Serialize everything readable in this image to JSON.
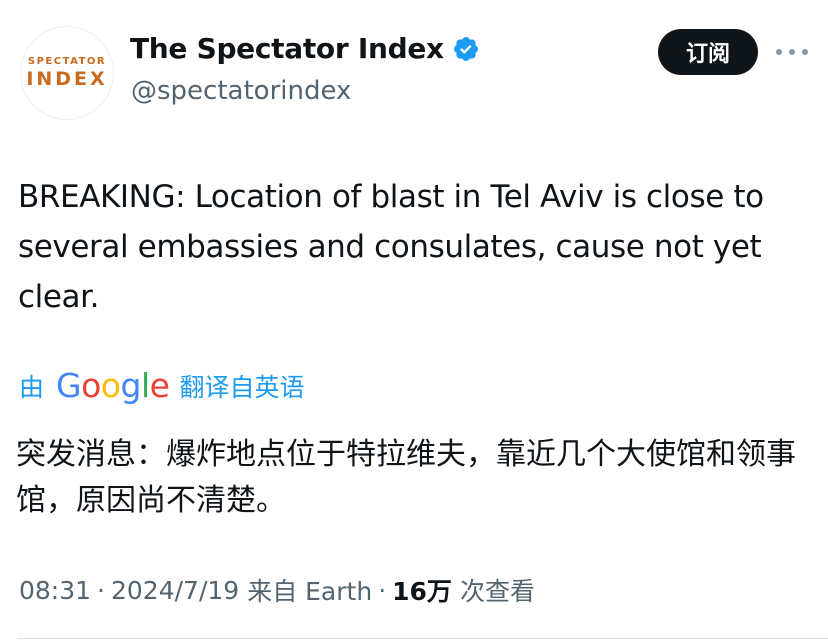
{
  "account": {
    "avatar_line1": "SPECTATOR",
    "avatar_line2": "INDEX",
    "display_name": "The Spectator Index",
    "handle": "@spectatorindex",
    "verified": true,
    "verified_color": "#1d9bf0"
  },
  "actions": {
    "subscribe_label": "订阅",
    "more_icon": "more-dots-icon"
  },
  "tweet": {
    "text": "BREAKING: Location of blast in Tel Aviv is close to several embassies and consulates, cause not yet clear."
  },
  "translation": {
    "by_label": "由",
    "google_letters": [
      "G",
      "o",
      "o",
      "g",
      "l",
      "e"
    ],
    "label": "翻译自英语",
    "text": "突发消息：爆炸地点位于特拉维夫，靠近几个大使馆和领事馆，原因尚不清楚。",
    "link_color": "#1d9bf0"
  },
  "meta": {
    "time": "08:31",
    "separator": "·",
    "date": "2024/7/19",
    "source": "来自 Earth",
    "views_count": "16万",
    "views_label": "次查看"
  }
}
